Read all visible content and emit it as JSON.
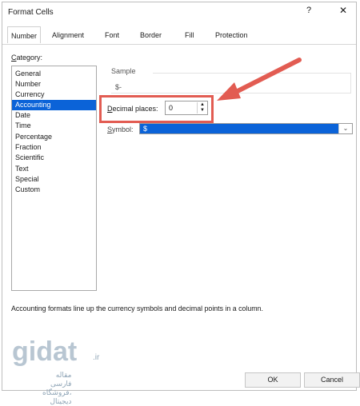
{
  "window": {
    "title": "Format Cells",
    "help_label": "?",
    "close_label": "✕"
  },
  "tabs": [
    {
      "label": "Number",
      "active": true
    },
    {
      "label": "Alignment",
      "active": false
    },
    {
      "label": "Font",
      "active": false
    },
    {
      "label": "Border",
      "active": false
    },
    {
      "label": "Fill",
      "active": false
    },
    {
      "label": "Protection",
      "active": false
    }
  ],
  "category": {
    "label_c": "C",
    "label_rest": "ategory:",
    "items": [
      {
        "label": "General"
      },
      {
        "label": "Number"
      },
      {
        "label": "Currency"
      },
      {
        "label": "Accounting",
        "selected": true
      },
      {
        "label": "Date"
      },
      {
        "label": "Time"
      },
      {
        "label": "Percentage"
      },
      {
        "label": "Fraction"
      },
      {
        "label": "Scientific"
      },
      {
        "label": "Text"
      },
      {
        "label": "Special"
      },
      {
        "label": "Custom"
      }
    ]
  },
  "sample": {
    "label": "Sample",
    "value": "$-"
  },
  "decimal_places": {
    "label_d": "D",
    "label_rest": "ecimal places:",
    "value": "0",
    "spin_up": "▲",
    "spin_down": "▼"
  },
  "symbol": {
    "label_s": "S",
    "label_rest": "ymbol:",
    "value": "$",
    "dropdown_icon": "⌄"
  },
  "description": "Accounting formats line up the currency symbols and decimal points in a column.",
  "buttons": {
    "ok": "OK",
    "cancel": "Cancel"
  },
  "watermark": {
    "brand": "gidat",
    "tld": ".ir",
    "subtitle": "مقاله فارسی ،فروشگاه دیجیتال"
  },
  "annotation": {
    "highlight_color": "#e25c52",
    "arrow_color": "#e25c52"
  }
}
